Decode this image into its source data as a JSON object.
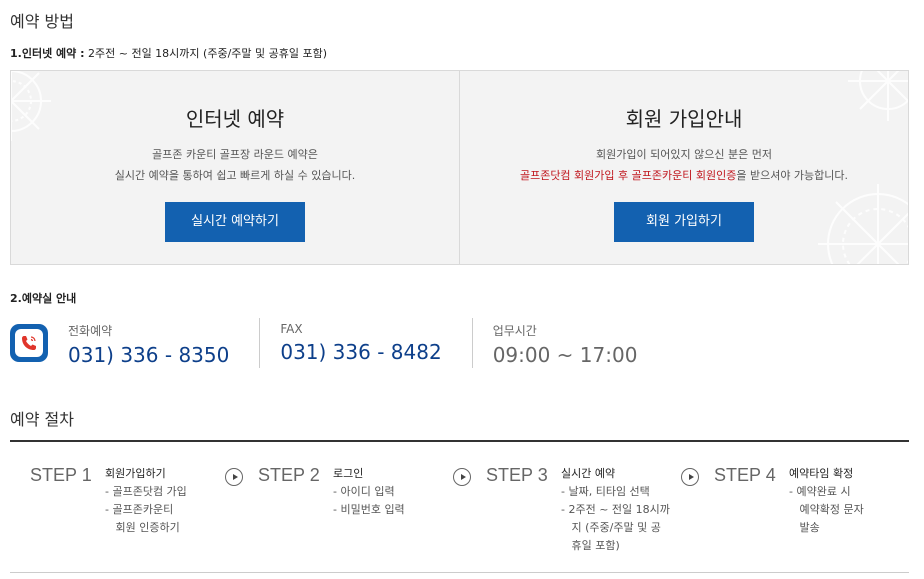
{
  "reservation_method": {
    "title": "예약 방법",
    "internet_heading": "1.인터넷 예약 :",
    "internet_desc": "2주전 ~ 전일 18시까지 (주중/주말 및 공휴일 포함)"
  },
  "panels": {
    "internet": {
      "title": "인터넷 예약",
      "line1": "골프존 카운티 골프장 라운드 예약은",
      "line2": "실시간 예약을 통하여 쉽고 빠르게 하실 수 있습니다.",
      "button": "실시간 예약하기"
    },
    "member": {
      "title": "회원 가입안내",
      "line1": "회원가입이 되어있지 않으신 분은 먼저",
      "line2_red": "골프존닷컴 회원가입 후 골프존카운티 회원인증",
      "line2_rest": "을 받으셔야 가능합니다.",
      "button": "회원 가입하기"
    }
  },
  "reservation_office": {
    "heading": "2.예약실 안내",
    "phone_label": "전화예약",
    "phone_value": "031) 336 - 8350",
    "fax_label": "FAX",
    "fax_value": "031) 336 - 8482",
    "hours_label": "업무시간",
    "hours_value": "09:00 ~ 17:00"
  },
  "procedure": {
    "title": "예약 절차",
    "steps": [
      {
        "num": "STEP 1",
        "title": "회원가입하기",
        "items": [
          "- 골프존닷컴 가입",
          "- 골프존카운티",
          "   회원 인증하기"
        ]
      },
      {
        "num": "STEP 2",
        "title": "로그인",
        "items": [
          "- 아이디 입력",
          "- 비밀번호 입력"
        ]
      },
      {
        "num": "STEP 3",
        "title": "실시간 예약",
        "items": [
          "- 날짜, 티타임 선택",
          "- 2주전 ~ 전일 18시까",
          "   지 (주중/주말 및 공",
          "   휴일 포함)"
        ]
      },
      {
        "num": "STEP 4",
        "title": "예약타임 확정",
        "items": [
          "- 예약완료 시",
          "   예약확정 문자",
          "   발송"
        ]
      }
    ]
  },
  "colors": {
    "accent": "#1361b0",
    "red": "#c0151c",
    "phone_text": "#0d3f8a"
  },
  "icons": {
    "phone": "phone-icon",
    "arrow": "arrow-right-circle-icon"
  }
}
